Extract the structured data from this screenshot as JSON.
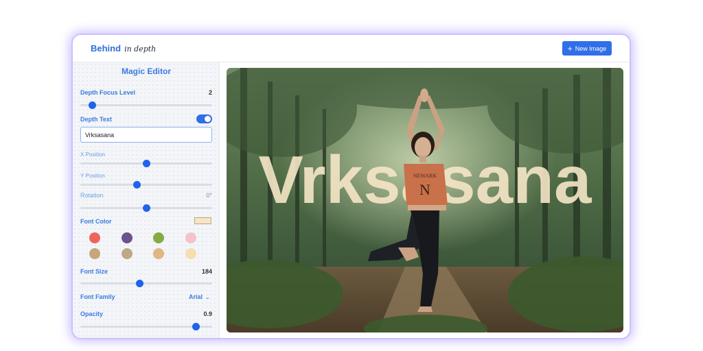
{
  "header": {
    "brand_main": "Behind",
    "brand_script": "in depth",
    "new_button": "New Image"
  },
  "editor": {
    "title": "Magic Editor",
    "depth_focus": {
      "label": "Depth Focus Level",
      "value": "2",
      "level": 0.09
    },
    "depth_text": {
      "label": "Depth Text",
      "enabled": true,
      "value": "Vrksasana",
      "placeholder": ""
    },
    "x_position": {
      "label": "X Position",
      "level": 0.5
    },
    "y_position": {
      "label": "Y Position",
      "level": 0.43
    },
    "rotation": {
      "label": "Rotation",
      "value": "0°",
      "level": 0.5
    },
    "font_color": {
      "label": "Font Color",
      "selected": "#f5e6c6",
      "swatches": [
        "#f0635a",
        "#6c528f",
        "#86ab45",
        "#f5c3c9",
        "#c7a67c",
        "#bfa885",
        "#e0b683",
        "#f5deb0"
      ]
    },
    "font_size": {
      "label": "Font Size",
      "value": "184",
      "level": 0.45
    },
    "font_family": {
      "label": "Font Family",
      "value": "Arial"
    },
    "opacity": {
      "label": "Opacity",
      "value": "0.9",
      "level": 0.88
    }
  },
  "canvas": {
    "overlay_text": "Vrksasana",
    "text_color": "#f5e6c6",
    "opacity": 0.9,
    "shirt_text": "NEWARK",
    "shirt_letter": "N"
  },
  "colors": {
    "accent": "#2f6fe8",
    "label_blue": "#3a7be0",
    "glow": "#c9c2ff"
  },
  "icons": {
    "new_button": "plus-icon",
    "font_family": "chevron-down-icon",
    "bottom_badge": "lightning-icon"
  }
}
